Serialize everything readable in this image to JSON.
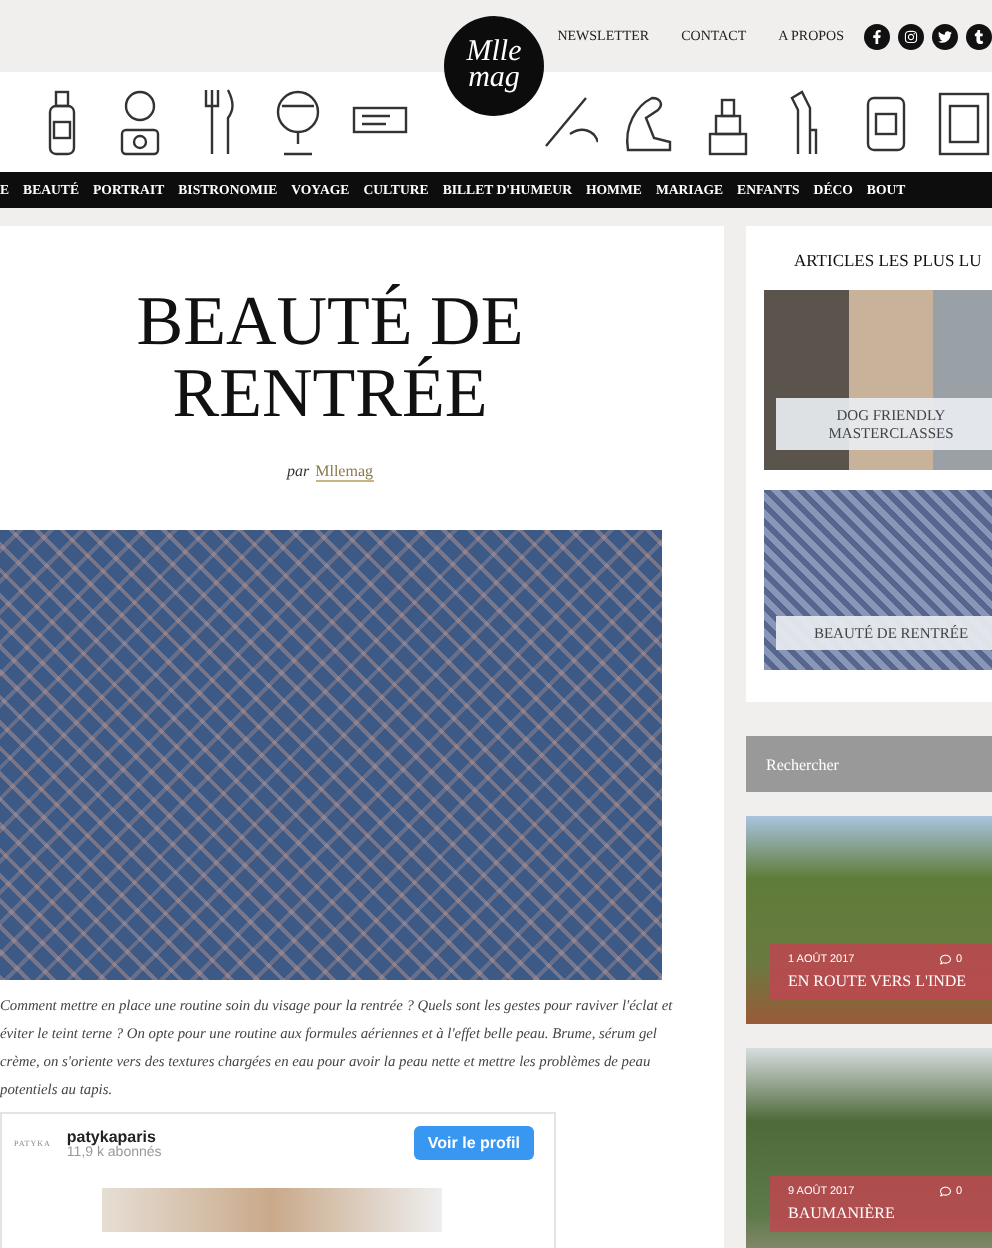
{
  "header": {
    "links": [
      "NEWSLETTER",
      "CONTACT",
      "A PROPOS"
    ],
    "social": [
      {
        "kind": "facebook"
      },
      {
        "kind": "instagram"
      },
      {
        "kind": "twitter"
      },
      {
        "kind": "tumblr"
      }
    ],
    "logo": {
      "line1": "Mlle",
      "line2": "mag"
    }
  },
  "nav": [
    "E",
    "BEAUTÉ",
    "PORTRAIT",
    "BISTRONOMIE",
    "VOYAGE",
    "CULTURE",
    "BILLET D'HUMEUR",
    "HOMME",
    "MARIAGE",
    "ENFANTS",
    "DÉCO",
    "BOUT"
  ],
  "article": {
    "title": "BEAUTÉ DE RENTRÉE",
    "byline_prefix": "par",
    "author": "Mllemag",
    "paragraph": "Comment mettre en place une routine soin du visage pour la rentrée ? Quels sont les gestes pour raviver l'éclat et éviter le teint terne ? On opte pour une routine aux formules aériennes et à l'effet belle peau. Brume, sérum gel crème, on s'oriente vers des textures chargées en eau pour avoir la peau nette et mettre les problèmes de peau potentiels au tapis.",
    "embed": {
      "logo": "PATYKA",
      "username": "patykaparis",
      "followers": "11,9 k abonnés",
      "button": "Voir le profil"
    }
  },
  "sidebar": {
    "popular_heading": "ARTICLES LES PLUS LU",
    "popular": [
      {
        "kind": "dog",
        "title": "DOG FRIENDLY MASTERCLASSES"
      },
      {
        "kind": "products",
        "title": "BEAUTÉ DE RENTRÉE"
      }
    ],
    "search": {
      "placeholder": "Rechercher"
    },
    "posts": [
      {
        "kind": "tree",
        "date": "1 AOÛT 2017",
        "comments": "0",
        "title": "EN ROUTE VERS L'INDE"
      },
      {
        "kind": "garden",
        "date": "9 AOÛT 2017",
        "comments": "0",
        "title": "BAUMANIÈRE"
      }
    ]
  }
}
